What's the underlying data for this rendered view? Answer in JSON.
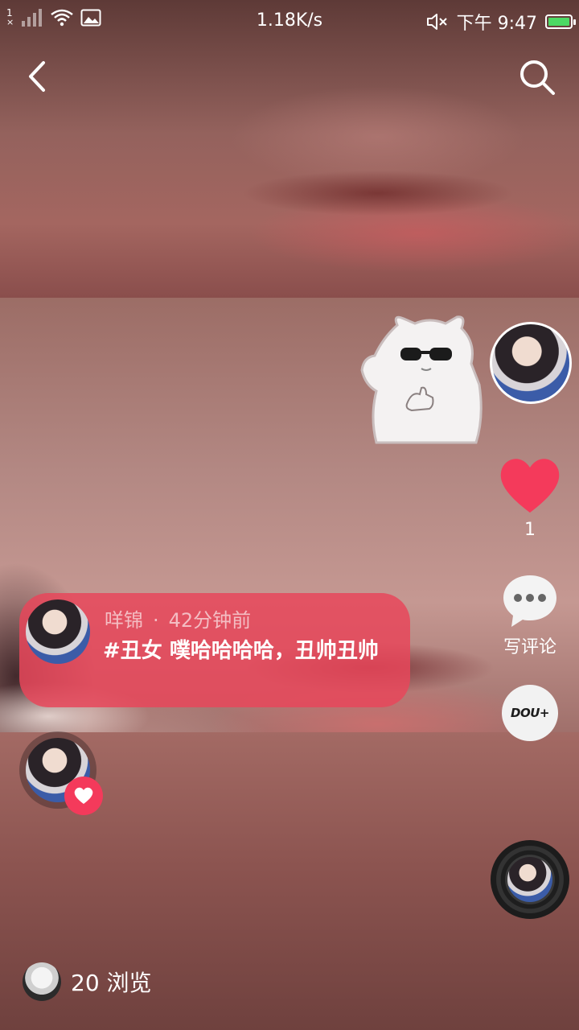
{
  "status_bar": {
    "sim": "1",
    "net_speed": "1.18K/s",
    "time": "下午 9:47",
    "battery_level": 0.85,
    "battery_color": "#4cd964"
  },
  "nav": {
    "back_icon": "chevron-left-icon",
    "search_icon": "search-icon"
  },
  "rail": {
    "like_count": "1",
    "comment_label": "写评论",
    "dou_label": "DOU+",
    "like_color": "#f43a5b"
  },
  "comment": {
    "username": "咩锦",
    "separator": "·",
    "time_ago": "42分钟前",
    "text": "#丑女 噗哈哈哈哈，丑帅丑帅",
    "bubble_color": "#e8465a"
  },
  "footer": {
    "views": "20 浏览"
  }
}
